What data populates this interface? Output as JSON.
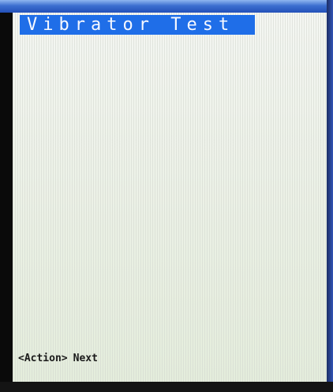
{
  "screen": {
    "title": "Vibrator Test"
  },
  "footer": {
    "key_label": "<Action>",
    "action_label": "Next"
  },
  "colors": {
    "title_bar": "#1f6ee8",
    "title_text": "#f7f9ff",
    "screen_background": "#eef2e6",
    "footer_text": "#1b1b1b"
  }
}
